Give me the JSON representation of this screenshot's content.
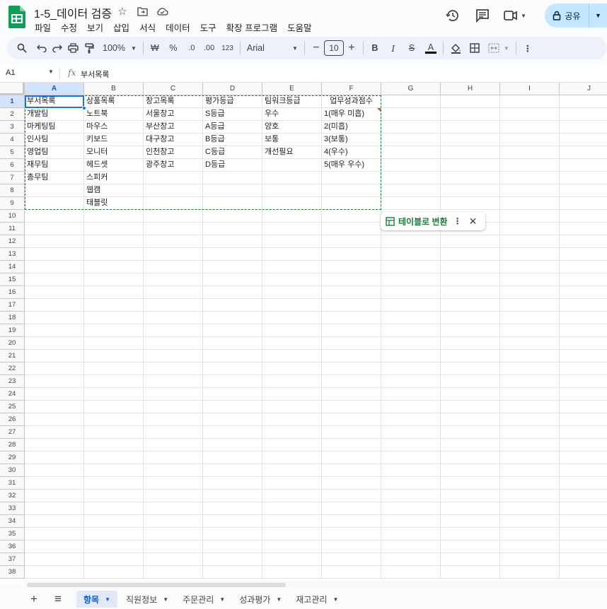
{
  "doc_title": "1-5_데이터 검증",
  "menu": [
    "파일",
    "수정",
    "보기",
    "삽입",
    "서식",
    "데이터",
    "도구",
    "확장 프로그램",
    "도움말"
  ],
  "share_label": "공유",
  "toolbar": {
    "zoom": "100%",
    "currency": "₩",
    "percent": "%",
    "dec_decrease": ".0",
    "dec_increase": ".00",
    "number_format": "123",
    "font": "Arial",
    "font_size": "10"
  },
  "formula_bar": {
    "cell_ref": "A1",
    "fx": "fx",
    "value": "부서목록"
  },
  "columns": [
    "A",
    "B",
    "C",
    "D",
    "E",
    "F",
    "G",
    "H",
    "I",
    "J"
  ],
  "rows": [
    "1",
    "2",
    "3",
    "4",
    "5",
    "6",
    "7",
    "8",
    "9",
    "10",
    "11",
    "12",
    "13",
    "14",
    "15",
    "16",
    "17",
    "18",
    "19",
    "20",
    "21",
    "22",
    "23",
    "24",
    "25",
    "26",
    "27",
    "28",
    "29",
    "30",
    "31",
    "32",
    "33",
    "34",
    "35",
    "36",
    "37",
    "38"
  ],
  "cells": [
    [
      "부서목록",
      "상품목록",
      "창고목록",
      "평가등급",
      "팀워크등급",
      "업무성과점수"
    ],
    [
      "개발팀",
      "노트북",
      "서울창고",
      "S등급",
      "우수",
      "1(매우 미흡)"
    ],
    [
      "마케팅팀",
      "마우스",
      "부산창고",
      "A등급",
      "양호",
      "2(미흡)"
    ],
    [
      "인사팀",
      "키보드",
      "대구창고",
      "B등급",
      "보통",
      "3(보통)"
    ],
    [
      "영업팀",
      "모니터",
      "인천창고",
      "C등급",
      "개선필요",
      "4(우수)"
    ],
    [
      "재무팀",
      "헤드셋",
      "광주창고",
      "D등급",
      "",
      "5(매우 우수)"
    ],
    [
      "총무팀",
      "스피커",
      "",
      "",
      "",
      ""
    ],
    [
      "",
      "웹캠",
      "",
      "",
      "",
      ""
    ],
    [
      "",
      "태블릿",
      "",
      "",
      "",
      ""
    ]
  ],
  "convert_chip": {
    "label": "테이블로 변환"
  },
  "sheet_tabs": [
    "항목",
    "직원정보",
    "주문관리",
    "성과평가",
    "재고관리"
  ],
  "colors": {
    "accent": "#0b57d0",
    "selection": "#1a73e8",
    "green": "#188038",
    "share_bg": "#c2e7ff"
  }
}
